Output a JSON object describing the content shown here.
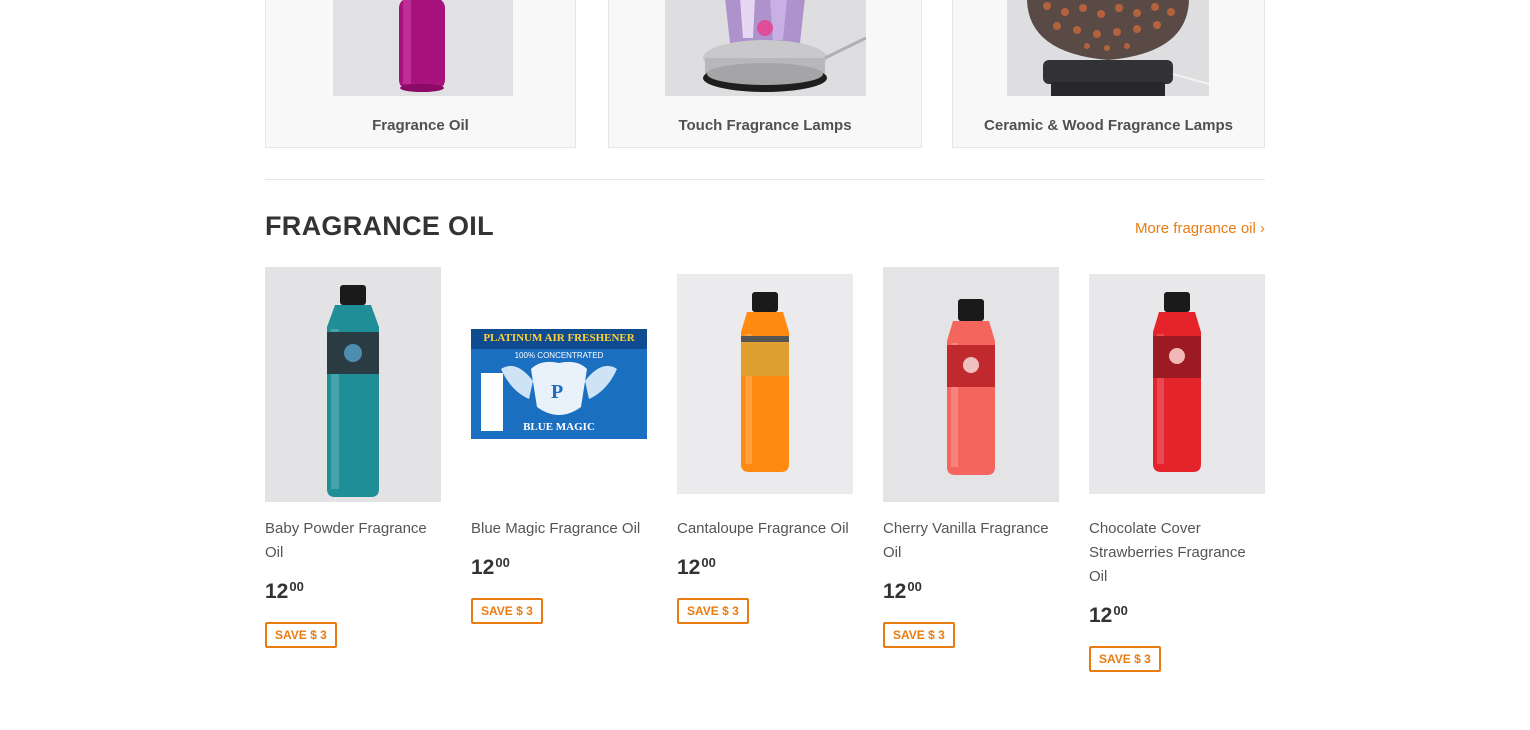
{
  "collections": [
    {
      "title": "Fragrance Oil",
      "image": "pink-fragrance-bottle-image"
    },
    {
      "title": "Touch Fragrance Lamps",
      "image": "touch-lamp-image"
    },
    {
      "title": "Ceramic & Wood Fragrance Lamps",
      "image": "ceramic-lamp-image"
    }
  ],
  "section": {
    "title": "FRAGRANCE OIL",
    "more_link": "More fragrance oil ›"
  },
  "products": [
    {
      "name": "Baby Powder Fragrance Oil",
      "price_int": "12",
      "price_cents": "00",
      "save": "SAVE $ 3",
      "liquid_color": "#1f8e96"
    },
    {
      "name": "Blue Magic Fragrance Oil",
      "price_int": "12",
      "price_cents": "00",
      "save": "SAVE $ 3",
      "label_top": "PLATINUM AIR FRESHENER",
      "label_sub": "100% CONCENTRATED",
      "label_bottom": "BLUE MAGIC",
      "label_mark": "P"
    },
    {
      "name": "Cantaloupe Fragrance Oil",
      "price_int": "12",
      "price_cents": "00",
      "save": "SAVE $ 3",
      "liquid_color": "#ff8a0f"
    },
    {
      "name": "Cherry Vanilla Fragrance Oil",
      "price_int": "12",
      "price_cents": "00",
      "save": "SAVE $ 3",
      "liquid_color": "#f4655e"
    },
    {
      "name": "Chocolate Cover Strawberries Fragrance Oil",
      "price_int": "12",
      "price_cents": "00",
      "save": "SAVE $ 3",
      "liquid_color": "#e5232b"
    }
  ],
  "colors": {
    "accent": "#ea7b11",
    "border": "#e6e6e6",
    "card_bg": "#f8f8f8"
  }
}
